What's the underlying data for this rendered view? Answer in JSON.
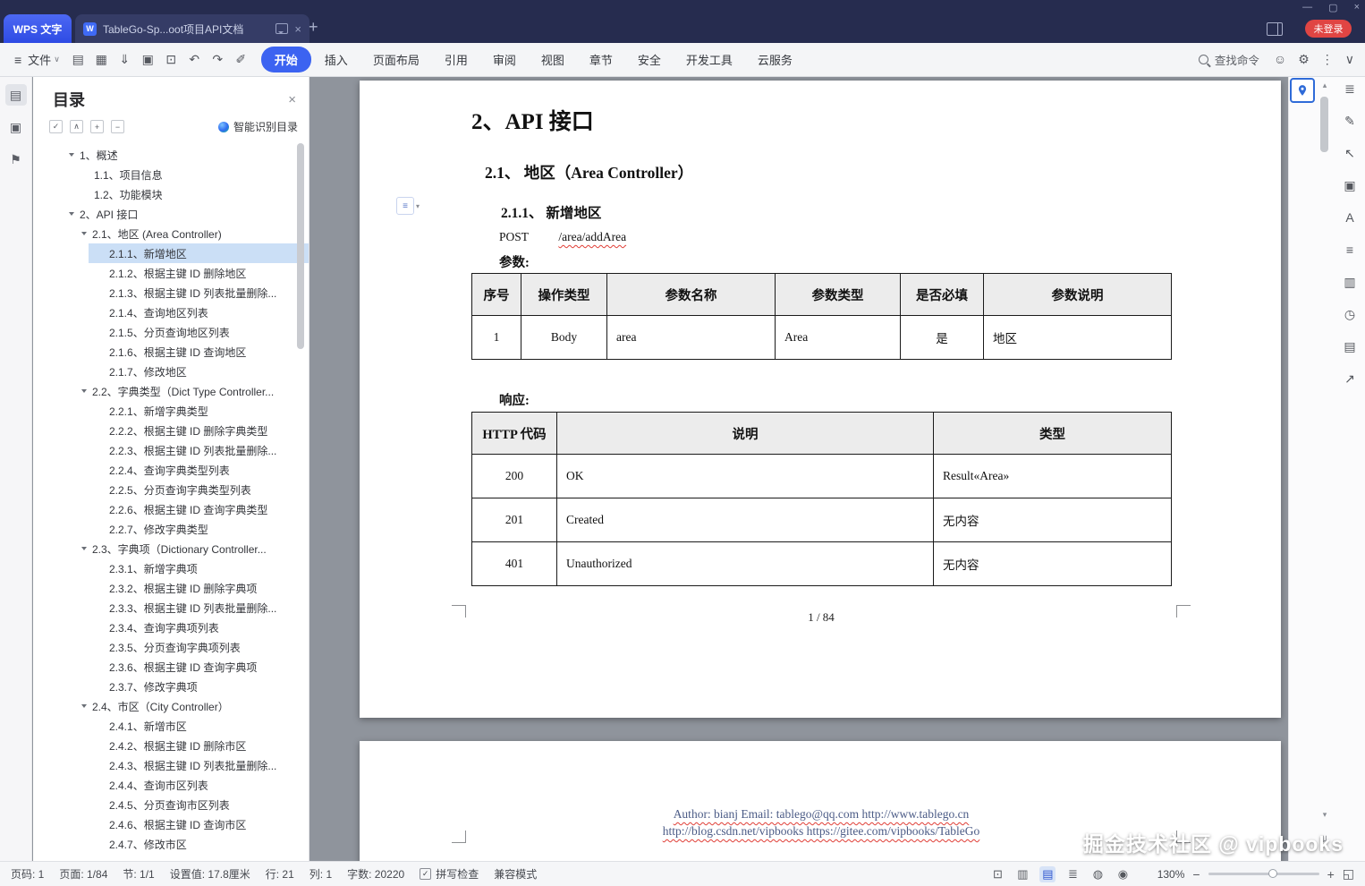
{
  "titlebar": {
    "app_tab_label": "WPS 文字",
    "doc_badge": "W",
    "doc_tab_title": "TableGo-Sp...oot项目API文档",
    "new_tab_label": "+",
    "login_badge": "未登录",
    "window_controls": [
      {
        "name": "minimize-button",
        "glyph": "—"
      },
      {
        "name": "maximize-button",
        "glyph": "▢"
      },
      {
        "name": "close-button",
        "glyph": "×"
      }
    ]
  },
  "ribbon": {
    "menu_glyph": "≡",
    "file_menu_label": "文件",
    "file_caret": "∨",
    "quick_tools": [
      {
        "name": "open-icon",
        "glyph": "▤"
      },
      {
        "name": "save-icon",
        "glyph": "▦"
      },
      {
        "name": "export-pdf-icon",
        "glyph": "⇓"
      },
      {
        "name": "print-icon",
        "glyph": "▣"
      },
      {
        "name": "print-preview-icon",
        "glyph": "⊡"
      },
      {
        "name": "undo-icon",
        "glyph": "↶"
      },
      {
        "name": "redo-icon",
        "glyph": "↷"
      },
      {
        "name": "format-painter-icon",
        "glyph": "✐"
      }
    ],
    "tabs": [
      {
        "name": "tab-home",
        "label": "开始",
        "active": true
      },
      {
        "name": "tab-insert",
        "label": "插入"
      },
      {
        "name": "tab-page-layout",
        "label": "页面布局"
      },
      {
        "name": "tab-references",
        "label": "引用"
      },
      {
        "name": "tab-review",
        "label": "审阅"
      },
      {
        "name": "tab-view",
        "label": "视图"
      },
      {
        "name": "tab-section",
        "label": "章节"
      },
      {
        "name": "tab-security",
        "label": "安全"
      },
      {
        "name": "tab-dev-tools",
        "label": "开发工具"
      },
      {
        "name": "tab-cloud",
        "label": "云服务"
      }
    ],
    "search_label": "查找命令",
    "right_icons": [
      {
        "name": "ai-assistant-icon",
        "glyph": "☺"
      },
      {
        "name": "settings-gear-icon",
        "glyph": "⚙"
      },
      {
        "name": "more-options-icon",
        "glyph": "⋮"
      },
      {
        "name": "collapse-ribbon-icon",
        "glyph": "∨"
      }
    ]
  },
  "left_strip": {
    "items": [
      {
        "name": "toc-panel-icon",
        "glyph": "▤",
        "active": true
      },
      {
        "name": "clipboard-panel-icon",
        "glyph": "▣"
      },
      {
        "name": "bookmark-panel-icon",
        "glyph": "⚑"
      }
    ]
  },
  "toc": {
    "title": "目录",
    "controls": [
      {
        "name": "check-all-icon",
        "glyph": "✓"
      },
      {
        "name": "collapse-all-icon",
        "glyph": "∧"
      },
      {
        "name": "expand-level-icon",
        "glyph": "+"
      },
      {
        "name": "collapse-level-icon",
        "glyph": "−"
      }
    ],
    "smart_button": "智能识别目录",
    "items": [
      {
        "label": "1、概述",
        "level": 1,
        "arrow": true
      },
      {
        "label": "1.1、项目信息",
        "level": 2,
        "arrow": false
      },
      {
        "label": "1.2、功能模块",
        "level": 2,
        "arrow": false
      },
      {
        "label": "2、API 接口",
        "level": 1,
        "arrow": true
      },
      {
        "label": "2.1、地区 (Area Controller)",
        "level": 2,
        "arrow": true
      },
      {
        "label": "2.1.1、新增地区",
        "level": 3,
        "arrow": false,
        "selected": true
      },
      {
        "label": "2.1.2、根据主键 ID 删除地区",
        "level": 3,
        "arrow": false
      },
      {
        "label": "2.1.3、根据主键 ID 列表批量删除...",
        "level": 3,
        "arrow": false
      },
      {
        "label": "2.1.4、查询地区列表",
        "level": 3,
        "arrow": false
      },
      {
        "label": "2.1.5、分页查询地区列表",
        "level": 3,
        "arrow": false
      },
      {
        "label": "2.1.6、根据主键 ID 查询地区",
        "level": 3,
        "arrow": false
      },
      {
        "label": "2.1.7、修改地区",
        "level": 3,
        "arrow": false
      },
      {
        "label": "2.2、字典类型（Dict Type Controller...",
        "level": 2,
        "arrow": true
      },
      {
        "label": "2.2.1、新增字典类型",
        "level": 3,
        "arrow": false
      },
      {
        "label": "2.2.2、根据主键 ID 删除字典类型",
        "level": 3,
        "arrow": false
      },
      {
        "label": "2.2.3、根据主键 ID 列表批量删除...",
        "level": 3,
        "arrow": false
      },
      {
        "label": "2.2.4、查询字典类型列表",
        "level": 3,
        "arrow": false
      },
      {
        "label": "2.2.5、分页查询字典类型列表",
        "level": 3,
        "arrow": false
      },
      {
        "label": "2.2.6、根据主键 ID 查询字典类型",
        "level": 3,
        "arrow": false
      },
      {
        "label": "2.2.7、修改字典类型",
        "level": 3,
        "arrow": false
      },
      {
        "label": "2.3、字典项（Dictionary Controller...",
        "level": 2,
        "arrow": true
      },
      {
        "label": "2.3.1、新增字典项",
        "level": 3,
        "arrow": false
      },
      {
        "label": "2.3.2、根据主键 ID 删除字典项",
        "level": 3,
        "arrow": false
      },
      {
        "label": "2.3.3、根据主键 ID 列表批量删除...",
        "level": 3,
        "arrow": false
      },
      {
        "label": "2.3.4、查询字典项列表",
        "level": 3,
        "arrow": false
      },
      {
        "label": "2.3.5、分页查询字典项列表",
        "level": 3,
        "arrow": false
      },
      {
        "label": "2.3.6、根据主键 ID 查询字典项",
        "level": 3,
        "arrow": false
      },
      {
        "label": "2.3.7、修改字典项",
        "level": 3,
        "arrow": false
      },
      {
        "label": "2.4、市区（City Controller）",
        "level": 2,
        "arrow": true
      },
      {
        "label": "2.4.1、新增市区",
        "level": 3,
        "arrow": false
      },
      {
        "label": "2.4.2、根据主键 ID 删除市区",
        "level": 3,
        "arrow": false
      },
      {
        "label": "2.4.3、根据主键 ID 列表批量删除...",
        "level": 3,
        "arrow": false
      },
      {
        "label": "2.4.4、查询市区列表",
        "level": 3,
        "arrow": false
      },
      {
        "label": "2.4.5、分页查询市区列表",
        "level": 3,
        "arrow": false
      },
      {
        "label": "2.4.6、根据主键 ID 查询市区",
        "level": 3,
        "arrow": false
      },
      {
        "label": "2.4.7、修改市区",
        "level": 3,
        "arrow": false
      }
    ]
  },
  "doc": {
    "heading1": "2、API 接口",
    "heading2": "2.1、 地区（Area Controller）",
    "heading3": "2.1.1、 新增地区",
    "method": "POST",
    "endpoint": "/area/addArea",
    "params_label": "参数:",
    "params_table": {
      "headers": [
        "序号",
        "操作类型",
        "参数名称",
        "参数类型",
        "是否必填",
        "参数说明"
      ],
      "rows": [
        [
          "1",
          "Body",
          "area",
          "Area",
          "是",
          "地区"
        ]
      ]
    },
    "response_label": "响应:",
    "response_table": {
      "headers": [
        "HTTP 代码",
        "说明",
        "类型"
      ],
      "rows": [
        [
          "200",
          "OK",
          "Result«Area»"
        ],
        [
          "201",
          "Created",
          "无内容"
        ],
        [
          "401",
          "Unauthorized",
          "无内容"
        ]
      ]
    },
    "page_indicator": "1 / 84",
    "page2_line1": "Author: bianj   Email: tablego@qq.com   http://www.tablego.cn",
    "page2_line2": "http://blog.csdn.net/vipbooks   https://gitee.com/vipbooks/TableGo"
  },
  "right_toolbar": {
    "items": [
      {
        "name": "nav-list-icon",
        "glyph": "≣"
      },
      {
        "name": "edit-pen-icon",
        "glyph": "✎"
      },
      {
        "name": "select-cursor-icon",
        "glyph": "↖"
      },
      {
        "name": "seal-lock-icon",
        "glyph": "▣"
      },
      {
        "name": "translate-icon",
        "glyph": "A"
      },
      {
        "name": "align-format-icon",
        "glyph": "≡"
      },
      {
        "name": "page-columns-icon",
        "glyph": "▥"
      },
      {
        "name": "history-version-icon",
        "glyph": "◷"
      },
      {
        "name": "read-layout-icon",
        "glyph": "▤"
      },
      {
        "name": "share-icon",
        "glyph": "↗"
      }
    ]
  },
  "watermark": "掘金技术社区 @ vipbooks",
  "statusbar": {
    "left_items": [
      "页码: 1",
      "页面: 1/84",
      "节: 1/1",
      "设置值: 17.8厘米",
      "行: 21",
      "列: 1",
      "字数: 20220"
    ],
    "spellcheck_label": "拼写检查",
    "compat_label": "兼容模式",
    "view_modes": [
      {
        "name": "fullscreen-icon",
        "glyph": "⊡"
      },
      {
        "name": "two-page-view-icon",
        "glyph": "▥"
      },
      {
        "name": "print-layout-icon",
        "glyph": "▤",
        "active": true
      },
      {
        "name": "outline-view-icon",
        "glyph": "≣"
      },
      {
        "name": "web-layout-icon",
        "glyph": "◍"
      },
      {
        "name": "eye-protection-icon",
        "glyph": "◉"
      }
    ],
    "zoom_value": "130%",
    "zoom_minus": "−",
    "zoom_plus": "+",
    "fit_glyph": "◱"
  },
  "colors": {
    "accent": "#3c63f1",
    "selection": "#cbdff6",
    "badge_red": "#e04543",
    "canvas_gray": "#8f949c"
  }
}
